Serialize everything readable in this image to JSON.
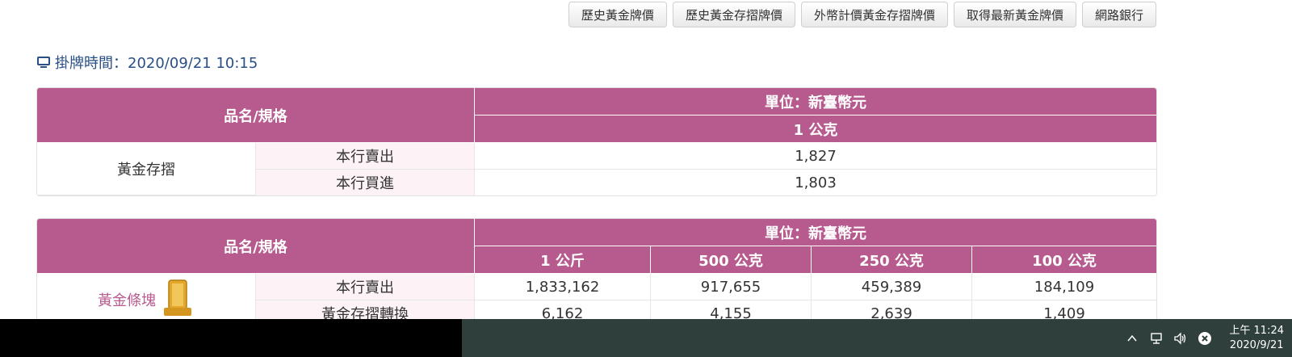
{
  "toolbar": {
    "buttons": [
      "歷史黃金牌價",
      "歷史黃金存摺牌價",
      "外幣計價黃金存摺牌價",
      "取得最新黃金牌價",
      "網路銀行"
    ]
  },
  "posted": {
    "label": "掛牌時間：2020/09/21 10:15",
    "icon": "monitor-icon"
  },
  "table1": {
    "header_name": "品名/規格",
    "unit": "單位：新臺幣元",
    "columns": [
      "1 公克"
    ],
    "product": "黃金存摺",
    "rows": [
      {
        "label": "本行賣出",
        "values": [
          "1,827"
        ]
      },
      {
        "label": "本行買進",
        "values": [
          "1,803"
        ]
      }
    ]
  },
  "table2": {
    "header_name": "品名/規格",
    "unit": "單位：新臺幣元",
    "columns": [
      "1 公斤",
      "500 公克",
      "250 公克",
      "100 公克"
    ],
    "product": "黃金條塊",
    "rows": [
      {
        "label": "本行賣出",
        "values": [
          "1,833,162",
          "917,655",
          "459,389",
          "184,109"
        ]
      },
      {
        "label": "黃金存摺轉換",
        "values": [
          "6,162",
          "4,155",
          "2,639",
          "1,409"
        ]
      }
    ]
  },
  "taskbar": {
    "time": "上午 11:24",
    "date": "2020/9/21",
    "icons": [
      "chevron-up-icon",
      "network-icon",
      "volume-icon",
      "close-circle-icon"
    ]
  },
  "colors": {
    "header_bg": "#b75b8f",
    "subcell_bg": "#fdf3f7",
    "link_blue": "#2a4f87",
    "taskbar_bg": "#2f3f3b"
  }
}
